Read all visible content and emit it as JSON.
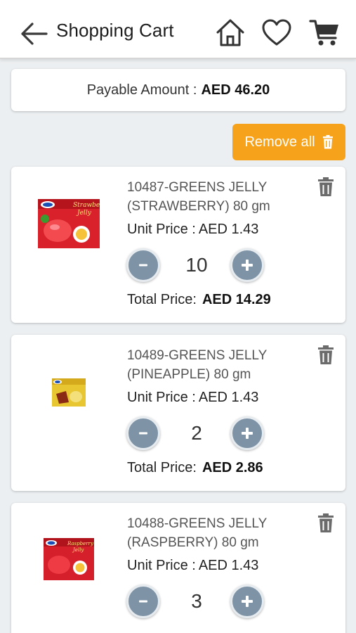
{
  "header": {
    "title": "Shopping Cart",
    "icons": [
      "back-arrow-icon",
      "home-icon",
      "heart-icon",
      "cart-icon"
    ]
  },
  "summary": {
    "payable_label": "Payable Amount :",
    "payable_value": "AED 46.20"
  },
  "actions": {
    "remove_all_label": "Remove all"
  },
  "labels": {
    "unit_price": "Unit Price :",
    "total_price": "Total Price:"
  },
  "items": [
    {
      "name": "10487-GREENS JELLY (STRAWBERRY) 80 gm",
      "unit_price": "AED 1.43",
      "quantity": "10",
      "total_price": "AED 14.29",
      "image_label": "Strawberry Jelly",
      "image_color": "#d8212a"
    },
    {
      "name": "10489-GREENS JELLY (PINEAPPLE) 80 gm",
      "unit_price": "AED 1.43",
      "quantity": "2",
      "total_price": "AED 2.86",
      "image_label": "Pineapple Jelly",
      "image_color": "#e8c631"
    },
    {
      "name": "10488-GREENS JELLY (RASPBERRY) 80 gm",
      "unit_price": "AED 1.43",
      "quantity": "3",
      "total_price": "",
      "image_label": "Raspberry Jelly",
      "image_color": "#d5202b"
    }
  ],
  "colors": {
    "accent": "#f7a21b",
    "qty_button": "#7e93a6",
    "background": "#eceff1"
  }
}
